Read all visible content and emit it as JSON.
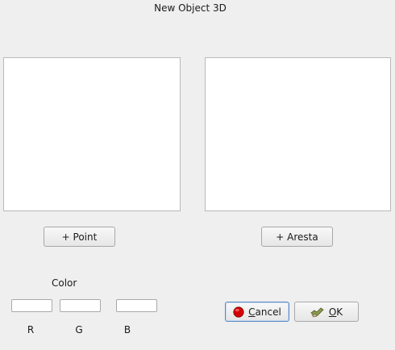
{
  "window": {
    "title": "New Object 3D"
  },
  "points_list": {
    "items": []
  },
  "edges_list": {
    "items": []
  },
  "buttons": {
    "add_point": "+ Point",
    "add_edge": "+ Aresta",
    "cancel_mnemonic": "C",
    "cancel_rest": "ancel",
    "ok_mnemonic": "O",
    "ok_rest": "K"
  },
  "color": {
    "label": "Color",
    "r_label": "R",
    "g_label": "G",
    "b_label": "B",
    "r_value": "",
    "g_value": "",
    "b_value": ""
  },
  "icons": {
    "cancel": "red-circle-icon",
    "ok": "check-hand-icon"
  },
  "colors": {
    "cancel_icon": "#d40000",
    "ok_icon": "#6b7f3a"
  }
}
